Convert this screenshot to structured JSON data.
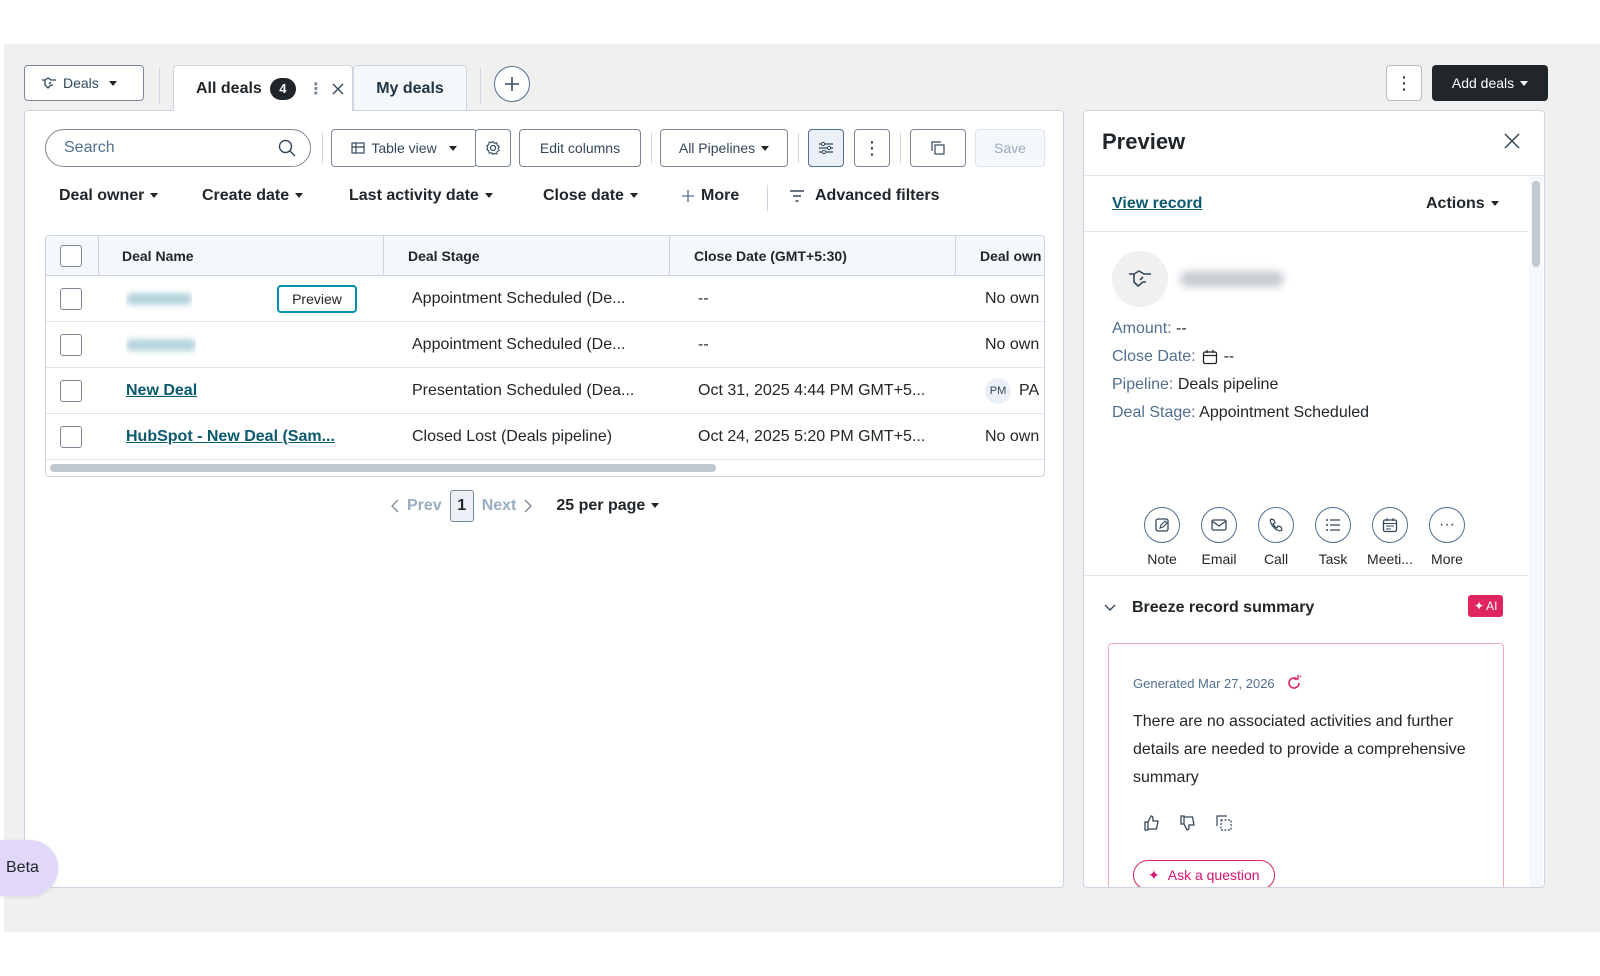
{
  "header": {
    "object_selector": "Deals",
    "tabs": [
      {
        "label": "All deals",
        "count": "4"
      },
      {
        "label": "My deals"
      }
    ],
    "add_deals_label": "Add deals"
  },
  "toolbar": {
    "search_placeholder": "Search",
    "table_view_label": "Table view",
    "edit_columns_label": "Edit columns",
    "pipelines_label": "All Pipelines",
    "save_label": "Save"
  },
  "filters": {
    "items": [
      "Deal owner",
      "Create date",
      "Last activity date",
      "Close date"
    ],
    "more_label": "More",
    "advanced_label": "Advanced filters"
  },
  "table": {
    "columns": [
      "Deal Name",
      "Deal Stage",
      "Close Date (GMT+5:30)",
      "Deal own"
    ],
    "rows": [
      {
        "name": "",
        "stage": "Appointment Scheduled (De...",
        "close_date": "--",
        "owner": "No own"
      },
      {
        "name": "",
        "stage": "Appointment Scheduled (De...",
        "close_date": "--",
        "owner": "No own"
      },
      {
        "name": "New Deal",
        "stage": "Presentation Scheduled (Dea...",
        "close_date": "Oct 31, 2025 4:44 PM GMT+5...",
        "owner_initials": "PM",
        "owner": "PA"
      },
      {
        "name": "HubSpot - New Deal (Sam...",
        "stage": "Closed Lost (Deals pipeline)",
        "close_date": "Oct 24, 2025 5:20 PM GMT+5...",
        "owner": "No own"
      }
    ],
    "row_preview_label": "Preview"
  },
  "pagination": {
    "prev_label": "Prev",
    "page": "1",
    "next_label": "Next",
    "per_page_label": "25 per page"
  },
  "preview": {
    "title": "Preview",
    "view_record_label": "View record",
    "actions_label": "Actions",
    "properties": [
      {
        "label": "Amount:",
        "value": "--"
      },
      {
        "label": "Close Date:",
        "value": "--"
      },
      {
        "label": "Pipeline:",
        "value": "Deals pipeline"
      },
      {
        "label": "Deal Stage:",
        "value": "Appointment Scheduled"
      }
    ],
    "activity_actions": [
      "Note",
      "Email",
      "Call",
      "Task",
      "Meeti...",
      "More"
    ],
    "summary": {
      "title": "Breeze record summary",
      "ai_badge": "AI",
      "generated": "Generated Mar 27, 2026",
      "text": "There are no associated activities and further details are needed to provide a comprehensive summary",
      "ask_label": "Ask a question"
    }
  },
  "beta_label": "Beta",
  "colors": {
    "accent_link": "#0b5a6e",
    "preview_border": "#0091ae",
    "ai_pink": "#e0245e",
    "dark": "#21262a"
  }
}
